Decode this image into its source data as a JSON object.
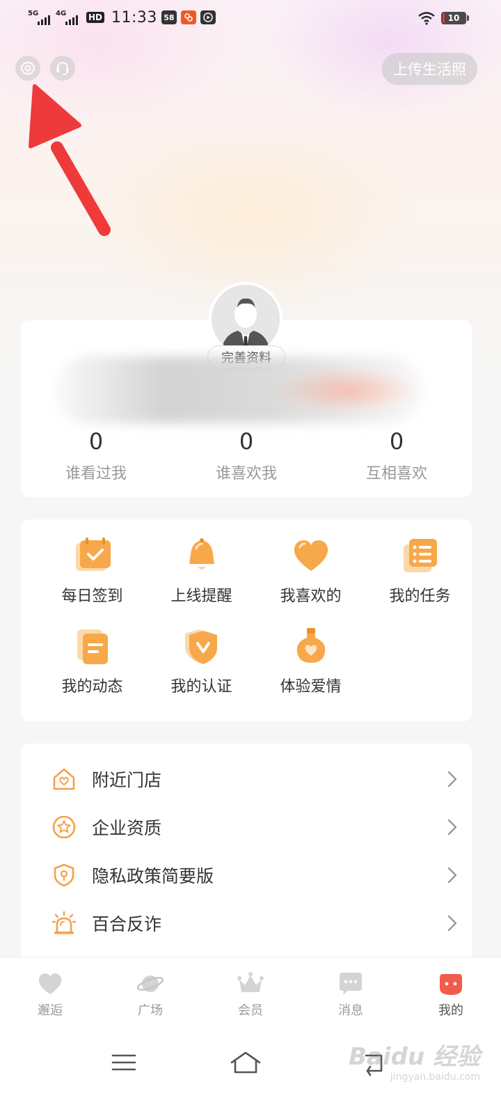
{
  "status_bar": {
    "network1": "5G",
    "network2": "4G",
    "hd": "HD",
    "time": "11:33",
    "chip1": "58",
    "battery": "10"
  },
  "header": {
    "upload_label": "上传生活照"
  },
  "profile": {
    "complete_label": "完善资料",
    "stats": [
      {
        "value": "0",
        "label": "谁看过我"
      },
      {
        "value": "0",
        "label": "谁喜欢我"
      },
      {
        "value": "0",
        "label": "互相喜欢"
      }
    ]
  },
  "features": [
    {
      "label": "每日签到",
      "icon": "calendar-check-icon"
    },
    {
      "label": "上线提醒",
      "icon": "bell-icon"
    },
    {
      "label": "我喜欢的",
      "icon": "heart-icon"
    },
    {
      "label": "我的任务",
      "icon": "task-list-icon"
    },
    {
      "label": "我的动态",
      "icon": "document-icon"
    },
    {
      "label": "我的认证",
      "icon": "verified-shield-icon"
    },
    {
      "label": "体验爱情",
      "icon": "love-potion-icon"
    }
  ],
  "menu": [
    {
      "label": "附近门店",
      "icon": "store-heart-icon"
    },
    {
      "label": "企业资质",
      "icon": "star-badge-icon"
    },
    {
      "label": "隐私政策简要版",
      "icon": "privacy-shield-icon"
    },
    {
      "label": "百合反诈",
      "icon": "alarm-icon"
    }
  ],
  "tabs": [
    {
      "label": "邂逅",
      "icon": "heart-icon"
    },
    {
      "label": "广场",
      "icon": "planet-icon"
    },
    {
      "label": "会员",
      "icon": "crown-icon"
    },
    {
      "label": "消息",
      "icon": "chat-icon"
    },
    {
      "label": "我的",
      "icon": "profile-face-icon"
    }
  ],
  "watermark": {
    "brand": "Baidu 经验",
    "url": "jingyan.baidu.com"
  },
  "colors": {
    "accent": "#f7a84a",
    "icon_orange": "#f5a04a",
    "arrow": "#ee3a3a",
    "active_tab": "#f25a4a"
  }
}
